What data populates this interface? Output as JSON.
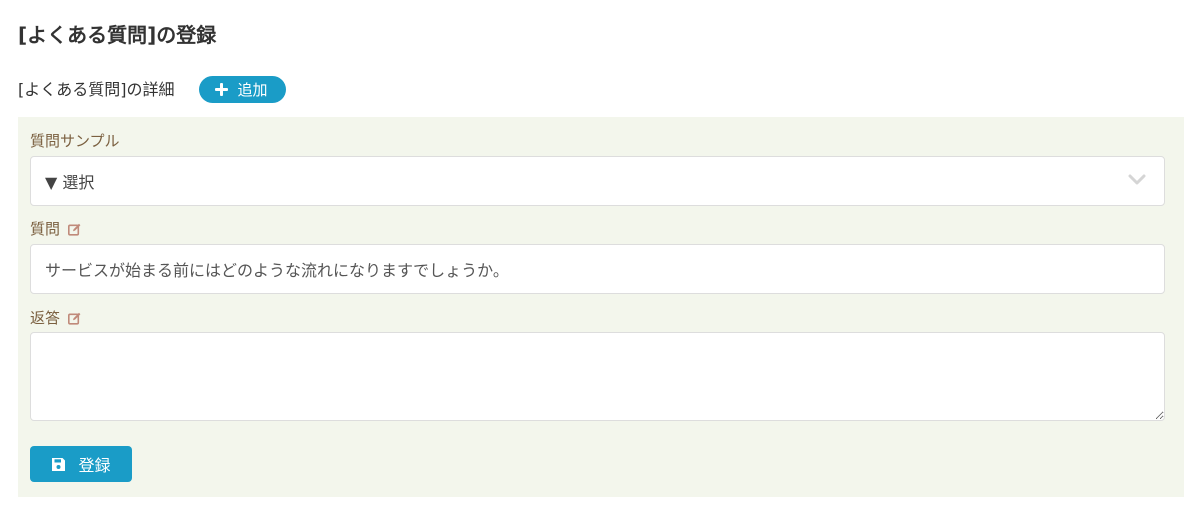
{
  "page": {
    "title": "[よくある質問]の登録"
  },
  "section": {
    "title": "[よくある質問]の詳細",
    "add_label": "追加"
  },
  "form": {
    "sample_label": "質問サンプル",
    "sample_select_value": "▼ 選択",
    "question_label": "質問",
    "question_value": "サービスが始まる前にはどのような流れになりますでしょうか。",
    "answer_label": "返答",
    "answer_value": "",
    "save_label": "登録"
  },
  "icons": {
    "add": "plus-icon",
    "edit": "edit-icon",
    "select": "chevron-down-icon",
    "save": "floppy-disk-icon"
  },
  "colors": {
    "accent": "#1a9cc7",
    "panel_background": "#f3f6ec",
    "label_text": "#7b6040",
    "edit_icon": "#c08a7a"
  }
}
